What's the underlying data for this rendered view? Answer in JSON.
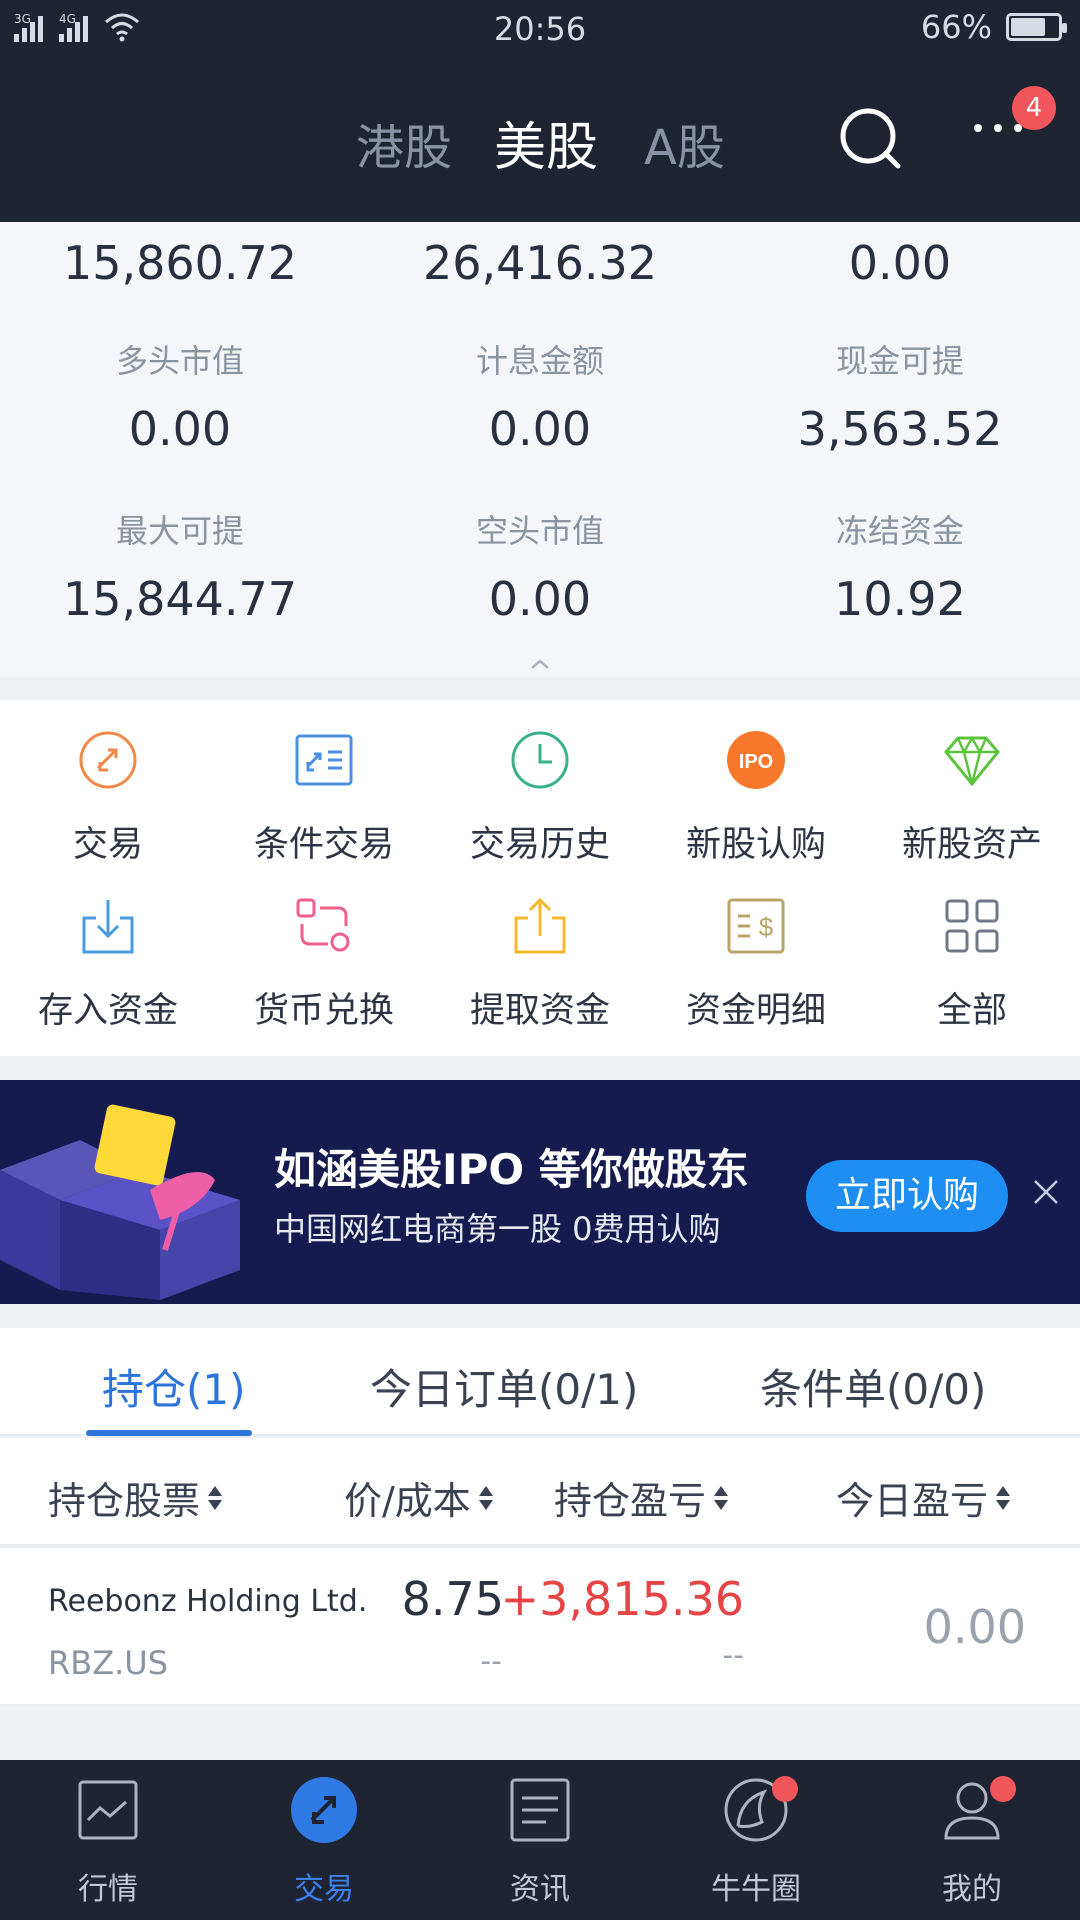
{
  "status_bar": {
    "network1": "3G",
    "network2": "4G",
    "time": "20:56",
    "battery": "66%"
  },
  "header": {
    "tabs": [
      {
        "label": "港股",
        "active": false
      },
      {
        "label": "美股",
        "active": true
      },
      {
        "label": "A股",
        "active": false
      }
    ],
    "notification_count": "4",
    "icons": [
      "search-icon",
      "more-icon"
    ]
  },
  "summary": {
    "top_values": [
      "15,860.72",
      "26,416.32",
      "0.00"
    ],
    "row2": [
      {
        "label": "多头市值",
        "value": "0.00"
      },
      {
        "label": "计息金额",
        "value": "0.00"
      },
      {
        "label": "现金可提",
        "value": "3,563.52"
      }
    ],
    "row3": [
      {
        "label": "最大可提",
        "value": "15,844.77"
      },
      {
        "label": "空头市值",
        "value": "0.00"
      },
      {
        "label": "冻结资金",
        "value": "10.92"
      }
    ]
  },
  "quick_actions": [
    {
      "label": "交易",
      "icon": "trade-icon",
      "color": "#f08a4b"
    },
    {
      "label": "条件交易",
      "icon": "conditional-trade-icon",
      "color": "#4a8fe0"
    },
    {
      "label": "交易历史",
      "icon": "history-clock-icon",
      "color": "#3bb08f"
    },
    {
      "label": "新股认购",
      "icon": "ipo-icon",
      "color": "#f7782a"
    },
    {
      "label": "新股资产",
      "icon": "diamond-icon",
      "color": "#5cc43c"
    },
    {
      "label": "存入资金",
      "icon": "deposit-icon",
      "color": "#4a9be0"
    },
    {
      "label": "货币兑换",
      "icon": "currency-exchange-icon",
      "color": "#ef5f8a"
    },
    {
      "label": "提取资金",
      "icon": "withdraw-icon",
      "color": "#f4b82a"
    },
    {
      "label": "资金明细",
      "icon": "fund-details-icon",
      "color": "#b9a56a"
    },
    {
      "label": "全部",
      "icon": "grid-icon",
      "color": "#6f7886"
    }
  ],
  "banner": {
    "title": "如涵美股IPO 等你做股东",
    "subtitle": "中国网红电商第一股  0费用认购",
    "button": "立即认购"
  },
  "position_tabs": [
    {
      "label": "持仓(1)",
      "active": true
    },
    {
      "label": "今日订单(0/1)",
      "active": false
    },
    {
      "label": "条件单(0/0)",
      "active": false
    }
  ],
  "table": {
    "headers": [
      "持仓股票",
      "价/成本",
      "持仓盈亏",
      "今日盈亏"
    ],
    "rows": [
      {
        "name": "Reebonz Holding Ltd.",
        "code": "RBZ.US",
        "price": "8.75",
        "cost": "--",
        "pl": "+3,815.36",
        "pl_pct": "--",
        "today": "0.00"
      }
    ]
  },
  "bottom_nav": [
    {
      "label": "行情",
      "icon": "market-chart-icon",
      "active": false,
      "dot": false
    },
    {
      "label": "交易",
      "icon": "trade-icon",
      "active": true,
      "dot": false
    },
    {
      "label": "资讯",
      "icon": "news-icon",
      "active": false,
      "dot": false
    },
    {
      "label": "牛牛圈",
      "icon": "community-icon",
      "active": false,
      "dot": true
    },
    {
      "label": "我的",
      "icon": "profile-icon",
      "active": false,
      "dot": true
    }
  ],
  "colors": {
    "header_bg": "#1f2433",
    "accent": "#2d74da",
    "profit_red": "#e64545",
    "banner_bg": "#151b4e"
  }
}
